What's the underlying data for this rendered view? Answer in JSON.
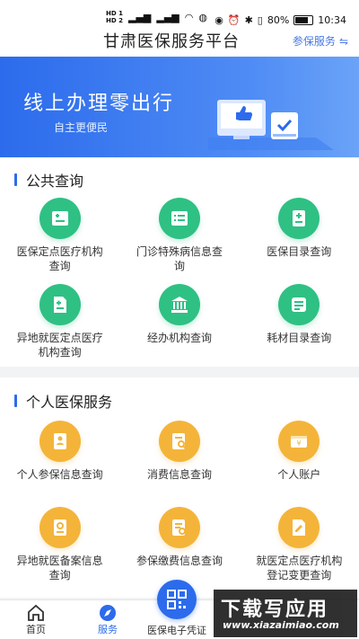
{
  "status_bar": {
    "sim1": "HD 1",
    "sim2": "HD 2",
    "battery": "80%",
    "time": "10:34"
  },
  "header": {
    "title": "甘肃医保服务平台",
    "switch_label": "参保服务"
  },
  "banner": {
    "title": "线上办理零出行",
    "subtitle": "自主更便民"
  },
  "public_query": {
    "title": "公共查询",
    "items": [
      {
        "label": "医保定点医疗机构查询",
        "icon": "hospital-card-icon"
      },
      {
        "label": "门诊特殊病信息查询",
        "icon": "list-icon"
      },
      {
        "label": "医保目录查询",
        "icon": "catalog-icon"
      },
      {
        "label": "异地就医定点医疗机构查询",
        "icon": "remote-card-icon"
      },
      {
        "label": "经办机构查询",
        "icon": "institution-icon"
      },
      {
        "label": "耗材目录查询",
        "icon": "materials-icon"
      }
    ]
  },
  "personal_service": {
    "title": "个人医保服务",
    "items": [
      {
        "label": "个人参保信息查询",
        "icon": "person-doc-icon"
      },
      {
        "label": "消费信息查询",
        "icon": "search-doc-icon"
      },
      {
        "label": "个人账户",
        "icon": "wallet-icon"
      },
      {
        "label": "异地就医备案信息查询",
        "icon": "filing-icon"
      },
      {
        "label": "参保缴费信息查询",
        "icon": "payment-doc-icon"
      },
      {
        "label": "就医定点医疗机构登记变更查询",
        "icon": "register-change-icon"
      }
    ]
  },
  "bottom_nav": {
    "home": "首页",
    "services": "服务",
    "qr": "医保电子凭证"
  },
  "watermark": {
    "main": "下载写应用",
    "url": "www.xiazaimiao.com"
  },
  "colors": {
    "primary": "#2c6bec",
    "green": "#2fc084",
    "orange": "#f4b43a"
  }
}
